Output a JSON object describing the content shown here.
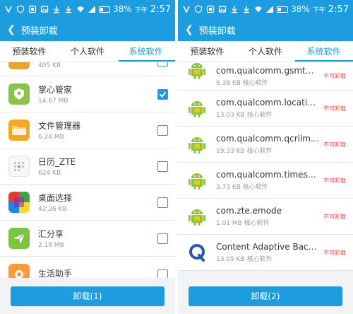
{
  "colors": {
    "accent": "#1d9ce0",
    "tag_red": "#e84a4a"
  },
  "status": {
    "battery": "38%",
    "time": "2:57",
    "ampm": "下午"
  },
  "left": {
    "title": "预装卸载",
    "tabs": [
      "预装软件",
      "个人软件",
      "系统软件"
    ],
    "active_tab": 2,
    "partial_size": "405 KB",
    "apps": [
      {
        "name": "掌心管家",
        "size": "14.67 MB",
        "checked": true,
        "icon": "shield-icon"
      },
      {
        "name": "文件管理器",
        "size": "6.24 MB",
        "checked": false,
        "icon": "folder-icon"
      },
      {
        "name": "日历_ZTE",
        "size": "624 KB",
        "checked": false,
        "icon": "calendar-icon"
      },
      {
        "name": "桌面选择",
        "size": "42.26 KB",
        "checked": false,
        "icon": "launcher-icon"
      },
      {
        "name": "汇分享",
        "size": "2.18 MB",
        "checked": false,
        "icon": "share-icon"
      },
      {
        "name": "生活助手",
        "size": "",
        "checked": false,
        "icon": "life-icon"
      }
    ],
    "button": "卸载(1)"
  },
  "right": {
    "title": "预装卸载",
    "tabs": [
      "预装软件",
      "个人软件",
      "系统软件"
    ],
    "active_tab": 2,
    "apps": [
      {
        "name": "com.qualcomm.gsmtunea.",
        "size": "6.38 KB 核心软件",
        "tag": "不可卸载",
        "icon": "android-icon"
      },
      {
        "name": "com.qualcomm.location.XT",
        "size": "13.03 KB 核心软件",
        "tag": "不可卸载",
        "icon": "android-icon"
      },
      {
        "name": "com.qualcomm.qcrilmsgtu.",
        "size": "19.33 KB 核心软件",
        "tag": "不可卸载",
        "icon": "android-icon"
      },
      {
        "name": "com.qualcomm.timeservice",
        "size": "3.73 KB 核心软件",
        "tag": "不可卸载",
        "icon": "android-icon"
      },
      {
        "name": "com.zte.emode",
        "size": "1.01 MB 核心软件",
        "tag": "不可卸载",
        "icon": "android-icon"
      },
      {
        "name": "Content Adaptive Backlight.",
        "size": "13.05 KB 核心软件",
        "tag": "不可卸载",
        "icon": "qualcomm-icon"
      }
    ],
    "button": "卸载(2)"
  }
}
